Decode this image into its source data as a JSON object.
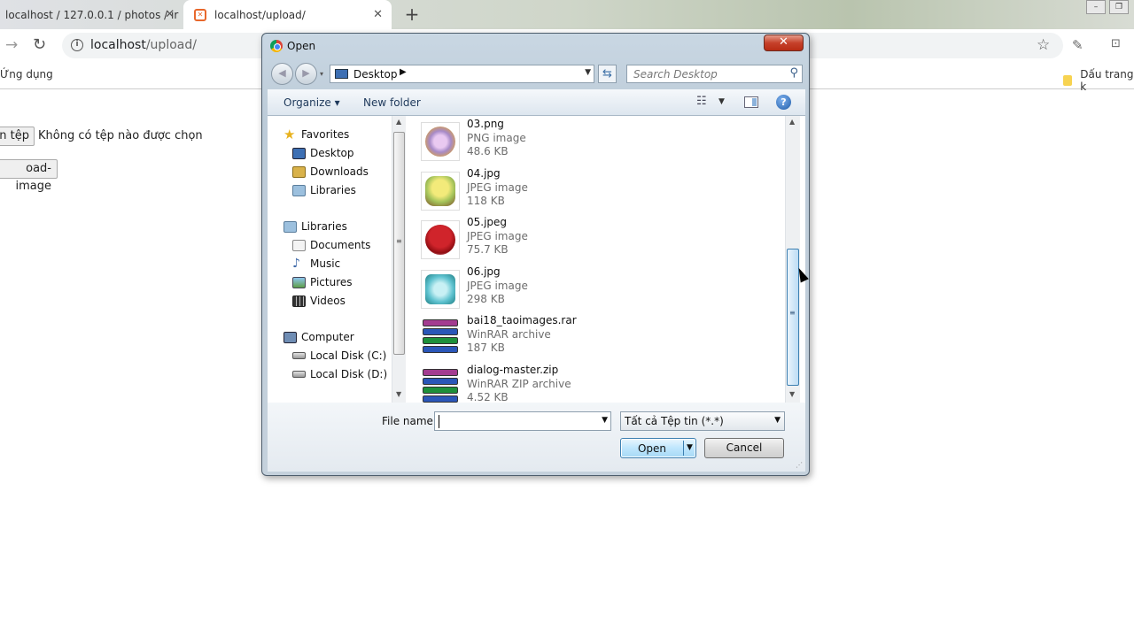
{
  "browser": {
    "tabs": [
      {
        "label": "localhost / 127.0.0.1 / photos / ir",
        "close": "✕"
      },
      {
        "label": "localhost/upload/",
        "close": "✕"
      }
    ],
    "new_tab": "+",
    "url_host": "localhost",
    "url_path": "/upload/",
    "bookmarks": {
      "apps": "Ứng dụng",
      "folder": "Dấu trang k"
    }
  },
  "page": {
    "choose_button": "n tệp",
    "no_file": "Không có tệp nào được chọn",
    "upload_button": "oad-image"
  },
  "dialog": {
    "title": "Open",
    "close": "✕",
    "location": "Desktop",
    "search_placeholder": "Search Desktop",
    "organize": "Organize ▾",
    "new_folder": "New folder",
    "nav": {
      "favorites": "Favorites",
      "desktop": "Desktop",
      "downloads": "Downloads",
      "libraries1": "Libraries",
      "libraries": "Libraries",
      "documents": "Documents",
      "music": "Music",
      "pictures": "Pictures",
      "videos": "Videos",
      "computer": "Computer",
      "disk_c": "Local Disk (C:)",
      "disk_d": "Local Disk (D:)"
    },
    "files": [
      {
        "name": "03.png",
        "type": "PNG image",
        "size": "48.6 KB"
      },
      {
        "name": "04.jpg",
        "type": "JPEG image",
        "size": "118 KB"
      },
      {
        "name": "05.jpeg",
        "type": "JPEG image",
        "size": "75.7 KB"
      },
      {
        "name": "06.jpg",
        "type": "JPEG image",
        "size": "298 KB"
      },
      {
        "name": "bai18_taoimages.rar",
        "type": "WinRAR archive",
        "size": "187 KB"
      },
      {
        "name": "dialog-master.zip",
        "type": "WinRAR ZIP archive",
        "size": "4.52 KB"
      }
    ],
    "file_name_label": "File name:",
    "file_name_value": "",
    "filter": "Tất cả Tệp tin (*.*)",
    "open": "Open",
    "cancel": "Cancel"
  }
}
